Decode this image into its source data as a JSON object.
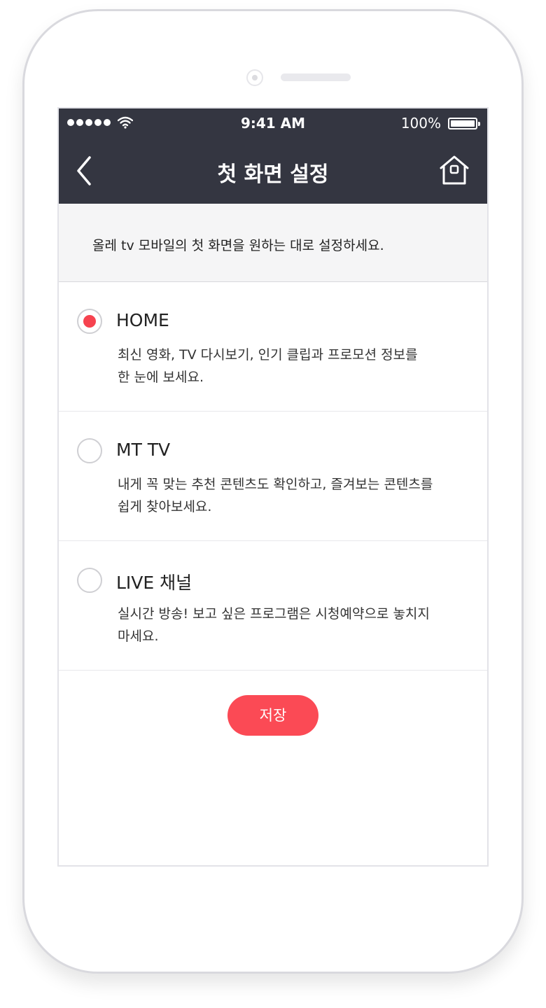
{
  "status_bar": {
    "time": "9:41 AM",
    "battery": "100%"
  },
  "nav": {
    "title": "첫 화면 설정",
    "back_icon": "chevron-left-icon",
    "home_icon": "home-icon"
  },
  "intro": "올레 tv 모바일의 첫 화면을 원하는 대로 설정하세요.",
  "options": [
    {
      "title": "HOME",
      "desc": "최신 영화, TV 다시보기, 인기 클립과 프로모션 정보를\n한 눈에 보세요.",
      "selected": true
    },
    {
      "title": "MT TV",
      "desc": "내게 꼭 맞는 추천 콘텐츠도 확인하고, 즐겨보는 콘텐츠를\n쉽게 찾아보세요.",
      "selected": false
    },
    {
      "title": "LIVE 채널",
      "desc": "실시간 방송! 보고 싶은 프로그램은 시청예약으로 놓치지\n마세요.",
      "selected": false
    }
  ],
  "save_label": "저장",
  "colors": {
    "header": "#343641",
    "accent": "#fb4a55"
  }
}
